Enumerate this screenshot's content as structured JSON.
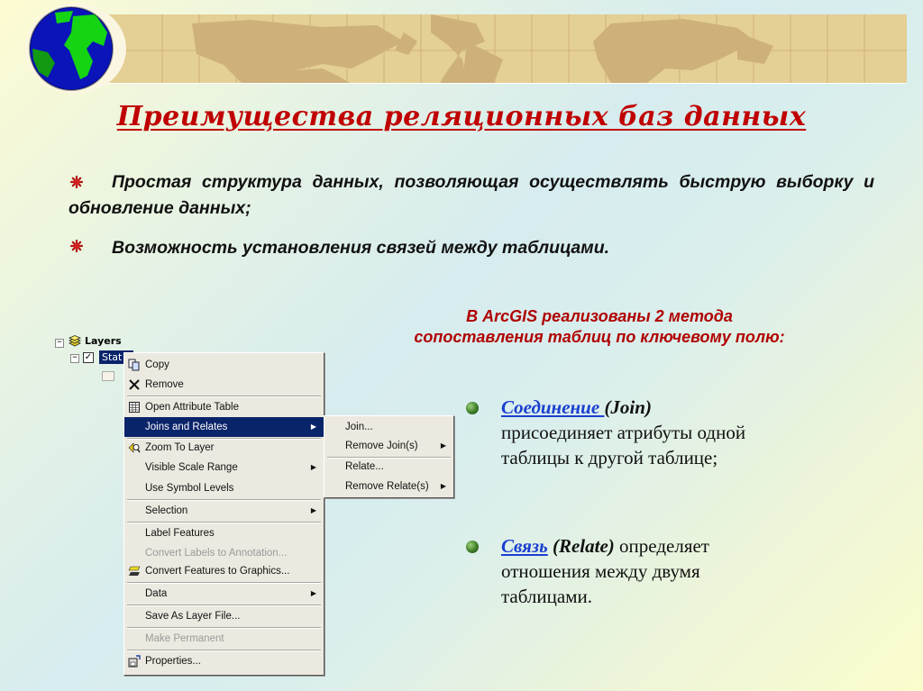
{
  "slide": {
    "title": "Преимущества реляционных баз данных",
    "points": [
      {
        "text": "Простая структура данных, позволяющая осуществлять быструю выборку и обновление данных;",
        "icon": "red-star-bullet-icon"
      },
      {
        "text": "Возможность  установления связей между таблицами.",
        "icon": "red-star-bullet-icon"
      }
    ],
    "arcgis_line1": "В ArcGIS реализованы 2 метода",
    "arcgis_line2": "сопоставления таблиц по ключевому полю:",
    "methods": [
      {
        "term": "Соединение ",
        "paren": "(Join)",
        "desc": "присоединяет атрибуты одной таблицы к другой таблице;"
      },
      {
        "term": "Связь",
        "paren": "(Relate)",
        "desc": "определяет отношения между двумя таблицами."
      }
    ],
    "colors": {
      "title": "#c00000",
      "subtitle": "#b00000",
      "link": "#1a3fd0",
      "menu_highlight": "#0a246a"
    }
  },
  "toc": {
    "root_label": "Layers",
    "layer_label": "Stat",
    "layer_checked": true
  },
  "context_menu": {
    "items": [
      {
        "label": "Copy",
        "icon": "copy-icon",
        "accel": "C"
      },
      {
        "label": "Remove",
        "icon": "remove-x-icon",
        "accel": "R"
      },
      {
        "label": "Open Attribute Table",
        "icon": "table-icon",
        "accel": "T"
      },
      {
        "label": "Joins and Relates",
        "submenu": true,
        "selected": true,
        "accel": "J"
      },
      {
        "label": "Zoom To Layer",
        "icon": "zoom-layer-icon",
        "accel": "Z"
      },
      {
        "label": "Visible Scale Range",
        "submenu": true,
        "accel": "V"
      },
      {
        "label": "Use Symbol Levels",
        "accel": "e"
      },
      {
        "label": "Selection",
        "submenu": true,
        "accel": "S"
      },
      {
        "label": "Label Features",
        "accel": "L"
      },
      {
        "label": "Convert Labels to Annotation...",
        "disabled": true,
        "accel": "n"
      },
      {
        "label": "Convert Features to Graphics...",
        "icon": "convert-graphics-icon",
        "accel": "F"
      },
      {
        "label": "Data",
        "submenu": true,
        "accel": "D"
      },
      {
        "label": "Save As Layer File...",
        "accel": "y"
      },
      {
        "label": "Make Permanent",
        "disabled": true,
        "accel": "M"
      },
      {
        "label": "Properties...",
        "icon": "properties-icon",
        "accel": "i"
      }
    ]
  },
  "submenu": {
    "items": [
      {
        "label": "Join...",
        "accel": "J"
      },
      {
        "label": "Remove Join(s)",
        "submenu": true,
        "accel": "e"
      },
      {
        "label": "Relate...",
        "accel": "R"
      },
      {
        "label": "Remove Relate(s)",
        "submenu": true,
        "accel": "m"
      }
    ]
  }
}
